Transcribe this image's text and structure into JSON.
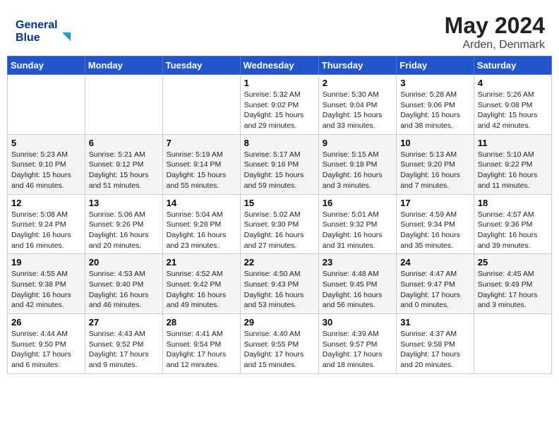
{
  "header": {
    "logo_line1": "General",
    "logo_line2": "Blue",
    "month_year": "May 2024",
    "location": "Arden, Denmark"
  },
  "weekdays": [
    "Sunday",
    "Monday",
    "Tuesday",
    "Wednesday",
    "Thursday",
    "Friday",
    "Saturday"
  ],
  "weeks": [
    [
      {
        "day": "",
        "info": ""
      },
      {
        "day": "",
        "info": ""
      },
      {
        "day": "",
        "info": ""
      },
      {
        "day": "1",
        "info": "Sunrise: 5:32 AM\nSunset: 9:02 PM\nDaylight: 15 hours\nand 29 minutes."
      },
      {
        "day": "2",
        "info": "Sunrise: 5:30 AM\nSunset: 9:04 PM\nDaylight: 15 hours\nand 33 minutes."
      },
      {
        "day": "3",
        "info": "Sunrise: 5:28 AM\nSunset: 9:06 PM\nDaylight: 15 hours\nand 38 minutes."
      },
      {
        "day": "4",
        "info": "Sunrise: 5:26 AM\nSunset: 9:08 PM\nDaylight: 15 hours\nand 42 minutes."
      }
    ],
    [
      {
        "day": "5",
        "info": "Sunrise: 5:23 AM\nSunset: 9:10 PM\nDaylight: 15 hours\nand 46 minutes."
      },
      {
        "day": "6",
        "info": "Sunrise: 5:21 AM\nSunset: 9:12 PM\nDaylight: 15 hours\nand 51 minutes."
      },
      {
        "day": "7",
        "info": "Sunrise: 5:19 AM\nSunset: 9:14 PM\nDaylight: 15 hours\nand 55 minutes."
      },
      {
        "day": "8",
        "info": "Sunrise: 5:17 AM\nSunset: 9:16 PM\nDaylight: 15 hours\nand 59 minutes."
      },
      {
        "day": "9",
        "info": "Sunrise: 5:15 AM\nSunset: 9:18 PM\nDaylight: 16 hours\nand 3 minutes."
      },
      {
        "day": "10",
        "info": "Sunrise: 5:13 AM\nSunset: 9:20 PM\nDaylight: 16 hours\nand 7 minutes."
      },
      {
        "day": "11",
        "info": "Sunrise: 5:10 AM\nSunset: 9:22 PM\nDaylight: 16 hours\nand 11 minutes."
      }
    ],
    [
      {
        "day": "12",
        "info": "Sunrise: 5:08 AM\nSunset: 9:24 PM\nDaylight: 16 hours\nand 16 minutes."
      },
      {
        "day": "13",
        "info": "Sunrise: 5:06 AM\nSunset: 9:26 PM\nDaylight: 16 hours\nand 20 minutes."
      },
      {
        "day": "14",
        "info": "Sunrise: 5:04 AM\nSunset: 9:28 PM\nDaylight: 16 hours\nand 23 minutes."
      },
      {
        "day": "15",
        "info": "Sunrise: 5:02 AM\nSunset: 9:30 PM\nDaylight: 16 hours\nand 27 minutes."
      },
      {
        "day": "16",
        "info": "Sunrise: 5:01 AM\nSunset: 9:32 PM\nDaylight: 16 hours\nand 31 minutes."
      },
      {
        "day": "17",
        "info": "Sunrise: 4:59 AM\nSunset: 9:34 PM\nDaylight: 16 hours\nand 35 minutes."
      },
      {
        "day": "18",
        "info": "Sunrise: 4:57 AM\nSunset: 9:36 PM\nDaylight: 16 hours\nand 39 minutes."
      }
    ],
    [
      {
        "day": "19",
        "info": "Sunrise: 4:55 AM\nSunset: 9:38 PM\nDaylight: 16 hours\nand 42 minutes."
      },
      {
        "day": "20",
        "info": "Sunrise: 4:53 AM\nSunset: 9:40 PM\nDaylight: 16 hours\nand 46 minutes."
      },
      {
        "day": "21",
        "info": "Sunrise: 4:52 AM\nSunset: 9:42 PM\nDaylight: 16 hours\nand 49 minutes."
      },
      {
        "day": "22",
        "info": "Sunrise: 4:50 AM\nSunset: 9:43 PM\nDaylight: 16 hours\nand 53 minutes."
      },
      {
        "day": "23",
        "info": "Sunrise: 4:48 AM\nSunset: 9:45 PM\nDaylight: 16 hours\nand 56 minutes."
      },
      {
        "day": "24",
        "info": "Sunrise: 4:47 AM\nSunset: 9:47 PM\nDaylight: 17 hours\nand 0 minutes."
      },
      {
        "day": "25",
        "info": "Sunrise: 4:45 AM\nSunset: 9:49 PM\nDaylight: 17 hours\nand 3 minutes."
      }
    ],
    [
      {
        "day": "26",
        "info": "Sunrise: 4:44 AM\nSunset: 9:50 PM\nDaylight: 17 hours\nand 6 minutes."
      },
      {
        "day": "27",
        "info": "Sunrise: 4:43 AM\nSunset: 9:52 PM\nDaylight: 17 hours\nand 9 minutes."
      },
      {
        "day": "28",
        "info": "Sunrise: 4:41 AM\nSunset: 9:54 PM\nDaylight: 17 hours\nand 12 minutes."
      },
      {
        "day": "29",
        "info": "Sunrise: 4:40 AM\nSunset: 9:55 PM\nDaylight: 17 hours\nand 15 minutes."
      },
      {
        "day": "30",
        "info": "Sunrise: 4:39 AM\nSunset: 9:57 PM\nDaylight: 17 hours\nand 18 minutes."
      },
      {
        "day": "31",
        "info": "Sunrise: 4:37 AM\nSunset: 9:58 PM\nDaylight: 17 hours\nand 20 minutes."
      },
      {
        "day": "",
        "info": ""
      }
    ]
  ]
}
